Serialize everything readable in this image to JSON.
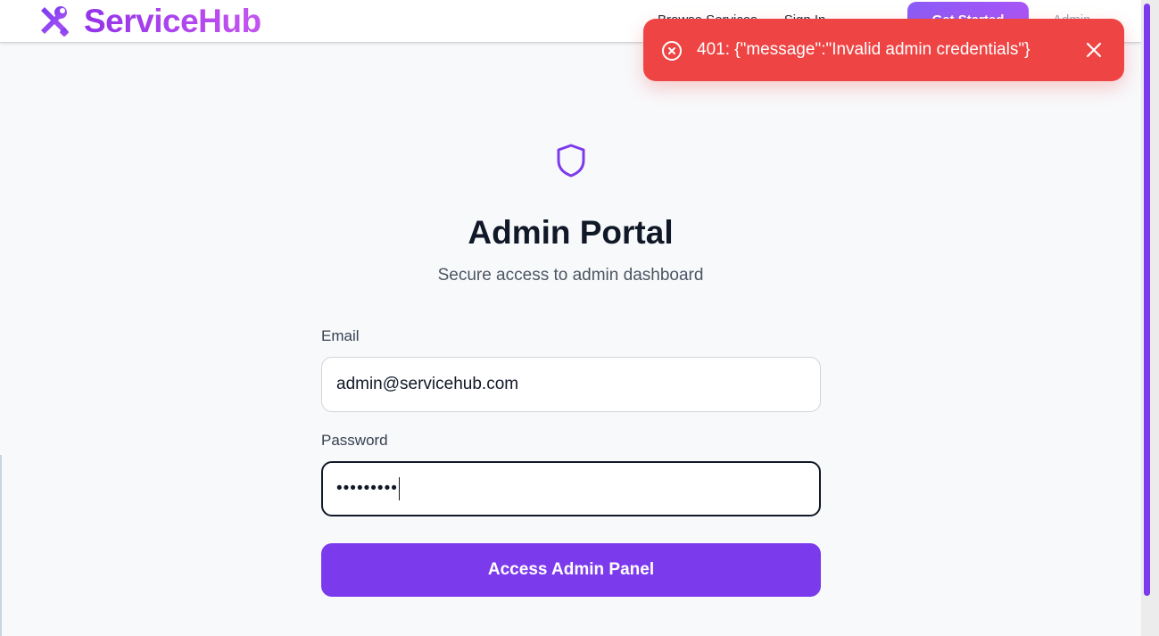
{
  "brand": {
    "name": "ServiceHub",
    "icon": "tools-icon"
  },
  "nav": {
    "links": [
      "Browse Services",
      "Sign In"
    ],
    "get_started": "Get Started",
    "admin": "Admin"
  },
  "toast": {
    "message": "401: {\"message\":\"Invalid admin credentials\"}",
    "icon": "x-circle-icon",
    "close_icon": "close-icon",
    "color": "#ef4444"
  },
  "login": {
    "icon": "shield-icon",
    "title": "Admin Portal",
    "subtitle": "Secure access to admin dashboard",
    "email_label": "Email",
    "email_value": "admin@servicehub.com",
    "password_label": "Password",
    "password_mask": "•••••••••",
    "submit_label": "Access Admin Panel"
  },
  "colors": {
    "accent": "#7c3aed",
    "error": "#ef4444",
    "background": "#f8f9fb"
  }
}
